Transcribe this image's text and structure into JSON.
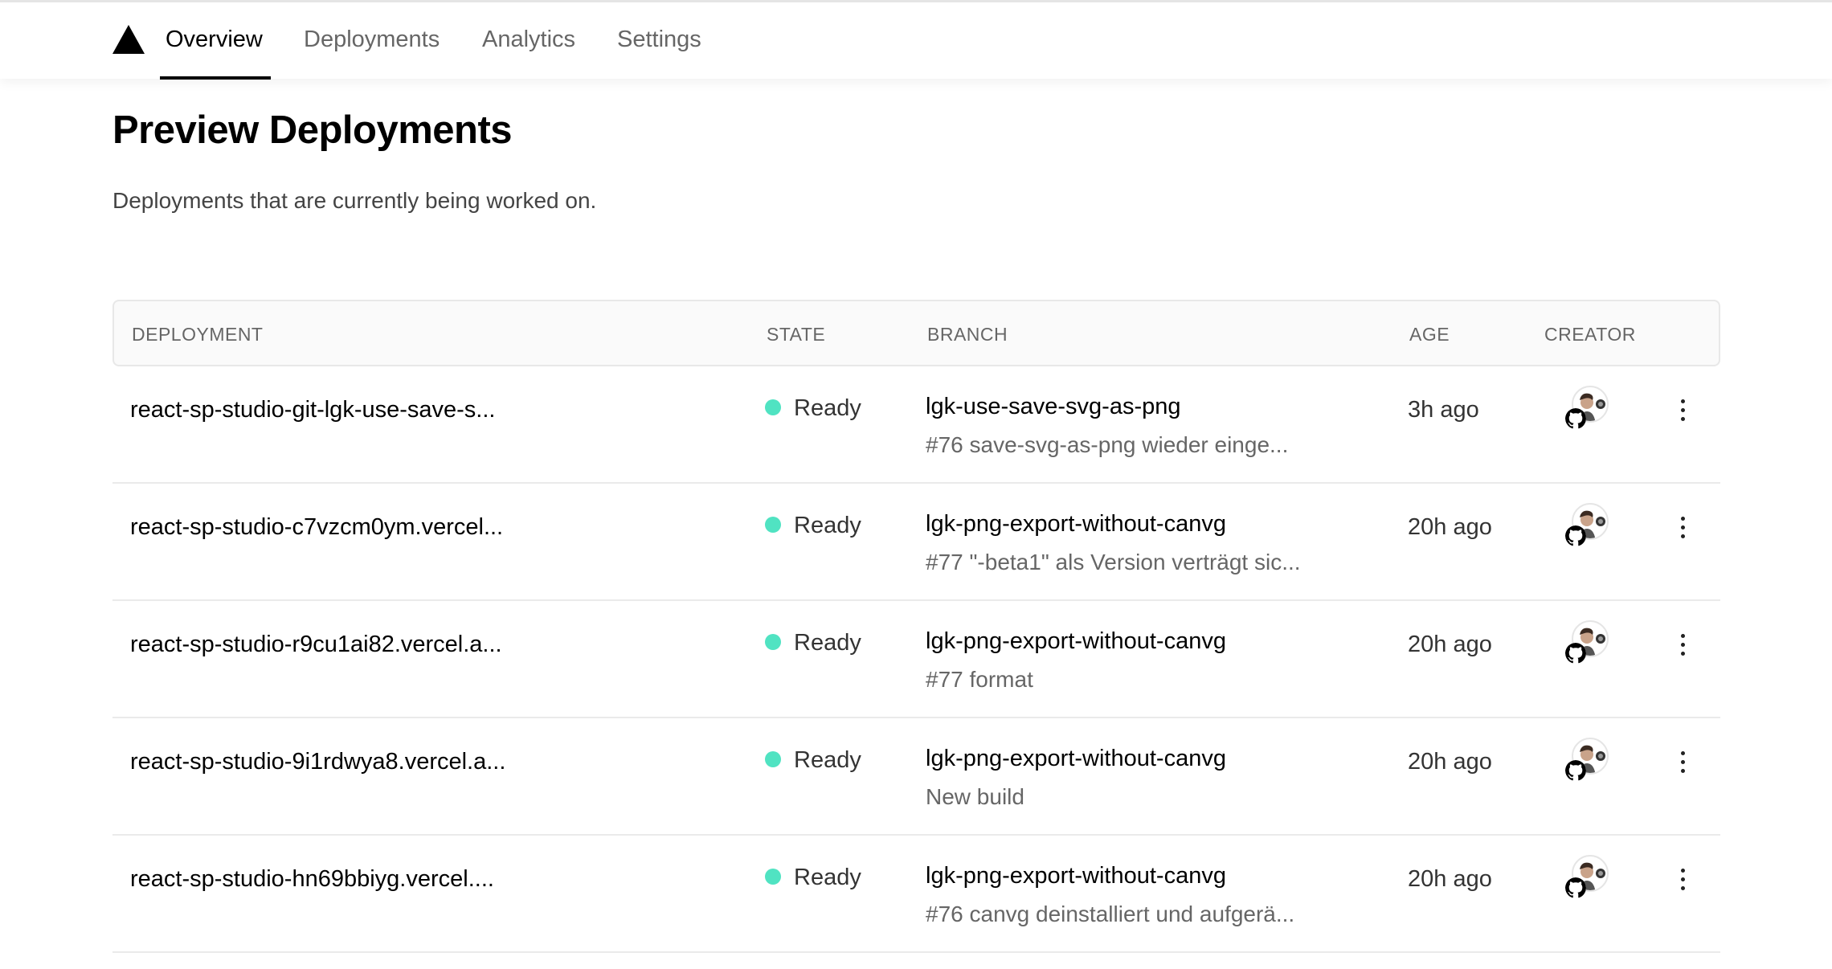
{
  "nav": {
    "tabs": [
      {
        "label": "Overview"
      },
      {
        "label": "Deployments"
      },
      {
        "label": "Analytics"
      },
      {
        "label": "Settings"
      }
    ]
  },
  "page": {
    "title": "Preview Deployments",
    "subtitle": "Deployments that are currently being worked on."
  },
  "table": {
    "headers": {
      "deployment": "DEPLOYMENT",
      "state": "STATE",
      "branch": "BRANCH",
      "age": "AGE",
      "creator": "CREATOR"
    },
    "rows": [
      {
        "deployment": "react-sp-studio-git-lgk-use-save-s...",
        "state": "Ready",
        "branch": "lgk-use-save-svg-as-png",
        "commit": "#76 save-svg-as-png wieder einge...",
        "age": "3h ago"
      },
      {
        "deployment": "react-sp-studio-c7vzcm0ym.vercel...",
        "state": "Ready",
        "branch": "lgk-png-export-without-canvg",
        "commit": "#77 \"-beta1\" als Version verträgt sic...",
        "age": "20h ago"
      },
      {
        "deployment": "react-sp-studio-r9cu1ai82.vercel.a...",
        "state": "Ready",
        "branch": "lgk-png-export-without-canvg",
        "commit": "#77 format",
        "age": "20h ago"
      },
      {
        "deployment": "react-sp-studio-9i1rdwya8.vercel.a...",
        "state": "Ready",
        "branch": "lgk-png-export-without-canvg",
        "commit": "New build",
        "age": "20h ago"
      },
      {
        "deployment": "react-sp-studio-hn69bbiyg.vercel....",
        "state": "Ready",
        "branch": "lgk-png-export-without-canvg",
        "commit": "#76 canvg deinstalliert und aufgerä...",
        "age": "20h ago"
      }
    ]
  },
  "colors": {
    "ready": "#50e3c2",
    "text": "#000000",
    "muted": "#666666"
  },
  "icons": {
    "logo": "triangle-logo-icon",
    "source": "github-icon",
    "menu": "more-vertical-icon"
  }
}
